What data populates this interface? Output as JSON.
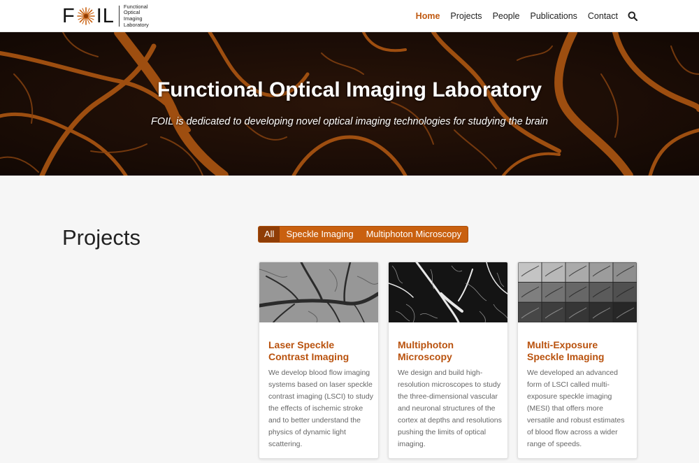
{
  "header": {
    "logo_mark_left": "F",
    "logo_mark_right": "IL",
    "logo_text_lines": [
      "Functional",
      "Optical",
      "Imaging",
      "Laboratory"
    ],
    "nav": [
      {
        "label": "Home",
        "active": true
      },
      {
        "label": "Projects",
        "active": false
      },
      {
        "label": "People",
        "active": false
      },
      {
        "label": "Publications",
        "active": false
      },
      {
        "label": "Contact",
        "active": false
      }
    ],
    "search_icon": "search-icon"
  },
  "hero": {
    "title": "Functional Optical Imaging Laboratory",
    "subtitle": "FOIL is dedicated to developing novel optical imaging technologies for studying the brain"
  },
  "projects": {
    "heading": "Projects",
    "filters": [
      {
        "label": "All",
        "active": true
      },
      {
        "label": "Speckle Imaging",
        "active": false
      },
      {
        "label": "Multiphoton Microscopy",
        "active": false
      }
    ],
    "cards": [
      {
        "title": "Laser Speckle Contrast Imaging",
        "description": "We develop blood flow imaging systems based on laser speckle contrast imaging (LSCI) to study the effects of ischemic stroke and to better understand the physics of dynamic light scattering."
      },
      {
        "title": "Multiphoton Microscopy",
        "description": "We design and build high-resolution microscopes to study the three-dimensional vascular and neuronal structures of the cortex at depths and resolutions pushing the limits of optical imaging."
      },
      {
        "title": "Multi-Exposure Speckle Imaging",
        "description": "We developed an advanced form of LSCI called multi-exposure speckle imaging (MESI) that offers more versatile and robust estimates of blood flow across a wider range of speeds."
      }
    ]
  },
  "colors": {
    "accent": "#c9600f",
    "accent_dark": "#8f3d06",
    "card_title": "#b9520e",
    "hero_vessel": "#b55a12"
  }
}
